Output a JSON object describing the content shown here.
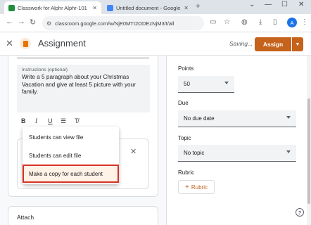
{
  "browser": {
    "tabs": [
      {
        "title": "Classwork for Alphr Alphr-101",
        "favicon_color": "#1e8e3e",
        "active": true
      },
      {
        "title": "Untitled document - Google D",
        "favicon_color": "#4285f4",
        "active": false
      }
    ],
    "close_glyph": "✕",
    "new_tab": "+",
    "window_controls": {
      "tabsearch": "⌄",
      "minimize": "—",
      "maximize": "☐",
      "close": "✕"
    },
    "url": "classroom.google.com/w/NjE0MTI2ODEzNjM3/t/all",
    "nav": {
      "back": "←",
      "forward": "→",
      "reload": "↻"
    },
    "profile_initial": "A"
  },
  "header": {
    "title": "Assignment",
    "status": "Saving...",
    "assign_label": "Assign",
    "accent": "#c5621c"
  },
  "instructions": {
    "label": "Instructions (optional)",
    "text": "Write a 5 paragraph about your Christmas Vacation and give at least 5 picture with your family."
  },
  "formatting": {
    "bold": "B",
    "italic": "I",
    "underline": "U",
    "list": "☰",
    "clear": "T̸"
  },
  "share_menu": {
    "items": [
      {
        "label": "Students can view file",
        "selected": false
      },
      {
        "label": "Students can edit file",
        "selected": false
      },
      {
        "label": "Make a copy for each student",
        "selected": true
      }
    ]
  },
  "attach": {
    "title": "Attach"
  },
  "settings": {
    "points": {
      "label": "Points",
      "value": "50"
    },
    "due": {
      "label": "Due",
      "value": "No due date"
    },
    "topic": {
      "label": "Topic",
      "value": "No topic"
    },
    "rubric": {
      "label": "Rubric",
      "button": "Rubric"
    }
  },
  "help": "?"
}
